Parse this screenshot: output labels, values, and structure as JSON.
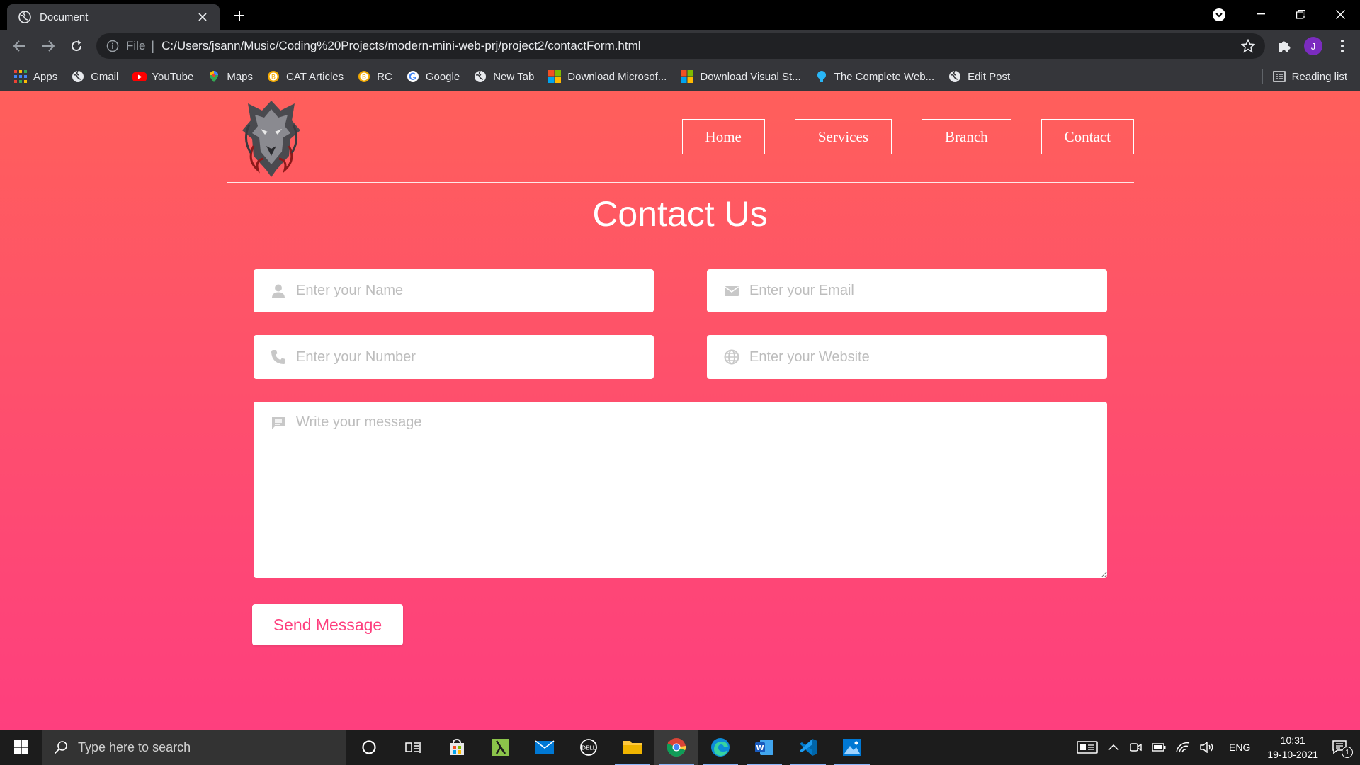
{
  "browser": {
    "tab_title": "Document",
    "scheme_label": "File",
    "url": "C:/Users/jsann/Music/Coding%20Projects/modern-mini-web-prj/project2/contactForm.html",
    "profile_initial": "J",
    "bookmarks": [
      {
        "label": "Apps",
        "icon": "apps-grid-icon"
      },
      {
        "label": "Gmail",
        "icon": "globe-icon"
      },
      {
        "label": "YouTube",
        "icon": "youtube-icon"
      },
      {
        "label": "Maps",
        "icon": "maps-pin-icon"
      },
      {
        "label": "CAT Articles",
        "icon": "bitcoin-icon"
      },
      {
        "label": "RC",
        "icon": "bitcoin-icon"
      },
      {
        "label": "Google",
        "icon": "google-icon"
      },
      {
        "label": "New Tab",
        "icon": "globe-icon"
      },
      {
        "label": "Download Microsof...",
        "icon": "microsoft-icon"
      },
      {
        "label": "Download Visual St...",
        "icon": "microsoft-icon"
      },
      {
        "label": "The Complete Web...",
        "icon": "udemy-icon"
      },
      {
        "label": "Edit Post",
        "icon": "globe-icon"
      }
    ],
    "reading_list_label": "Reading list"
  },
  "site": {
    "nav": {
      "home": "Home",
      "services": "Services",
      "branch": "Branch",
      "contact": "Contact"
    },
    "title": "Contact Us",
    "form": {
      "name_placeholder": "Enter your Name",
      "email_placeholder": "Enter your Email",
      "number_placeholder": "Enter your Number",
      "website_placeholder": "Enter your Website",
      "message_placeholder": "Write your message",
      "submit_label": "Send Message"
    }
  },
  "taskbar": {
    "search_placeholder": "Type here to search",
    "language": "ENG",
    "time": "10:31",
    "date": "19-10-2021",
    "notification_count": "1"
  },
  "colors": {
    "page_gradient_top": "#ff5f5b",
    "page_gradient_bottom": "#fe3f7e",
    "button_text": "#fe3f7e"
  }
}
